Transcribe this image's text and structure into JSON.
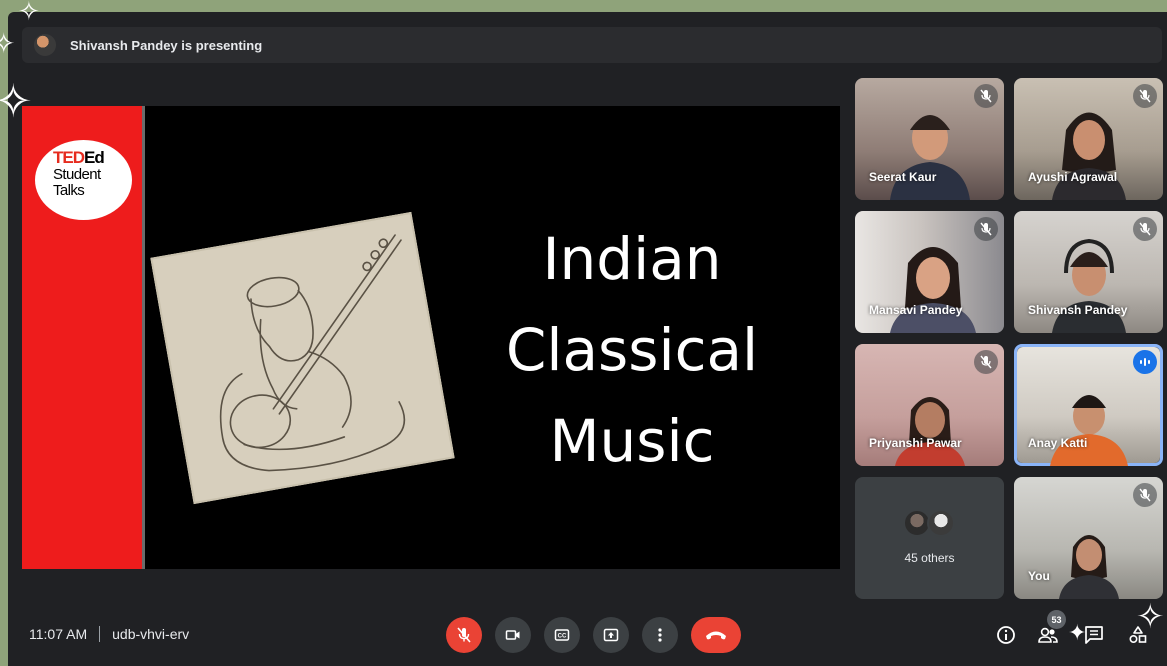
{
  "presenter": {
    "text": "Shivansh Pandey is presenting"
  },
  "slide": {
    "logo_ted": "TED",
    "logo_ed": "Ed",
    "logo_line2": "Student",
    "logo_line3": "Talks",
    "title_lines": [
      "Indian",
      "Classical",
      "Music"
    ]
  },
  "participants": [
    {
      "name": "Seerat Kaur",
      "muted": true
    },
    {
      "name": "Ayushi Agrawal",
      "muted": true
    },
    {
      "name": "Mansavi Pandey",
      "muted": true
    },
    {
      "name": "Shivansh Pandey",
      "muted": true
    },
    {
      "name": "Priyanshi Pawar",
      "muted": true
    },
    {
      "name": "Anay Katti",
      "muted": false,
      "speaking": true
    },
    {
      "name": "You",
      "muted": true
    }
  ],
  "others": {
    "label": "45 others"
  },
  "meeting": {
    "time": "11:07 AM",
    "code": "udb-vhvi-erv"
  },
  "controls": [
    "mic-off",
    "camera",
    "captions",
    "present-now",
    "more-options",
    "leave-call"
  ],
  "right_panel": {
    "people_count": "53"
  },
  "colors": {
    "background": "#8fa37a",
    "frame": "#202124",
    "accent_red": "#ea4335",
    "active_blue": "#1a73e8",
    "slide_red": "#ee1c1c"
  }
}
